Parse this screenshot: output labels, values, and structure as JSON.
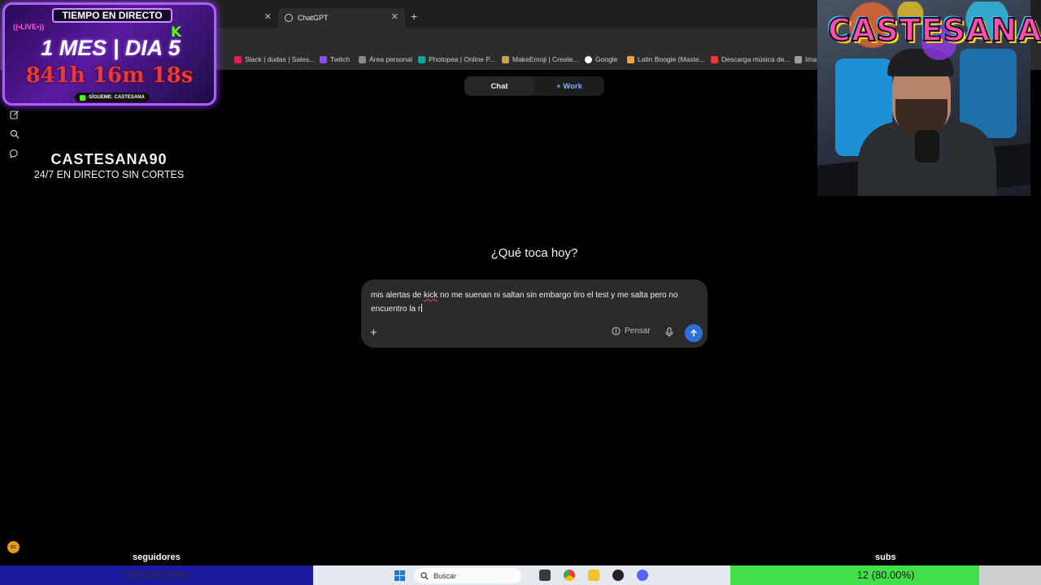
{
  "browser": {
    "active_tab_title": "ChatGPT",
    "bookmarks": [
      {
        "label": "Slack | dudas | Sales...",
        "color": "#e01e5a"
      },
      {
        "label": "Twitch",
        "color": "#9146ff"
      },
      {
        "label": "Área personal",
        "color": "#888888"
      },
      {
        "label": "Photopea | Online P...",
        "color": "#18a497"
      },
      {
        "label": "MakeEmoji | Create...",
        "color": "#c8a24a"
      },
      {
        "label": "Google",
        "color": "#ffffff"
      },
      {
        "label": "Latin Boogie (Maste...",
        "color": "#f2a33a"
      },
      {
        "label": "Descarga música de...",
        "color": "#e53935"
      },
      {
        "label": "Ima",
        "color": "#9e9e9e"
      }
    ]
  },
  "chatgpt": {
    "mode_chat": "Chat",
    "mode_work": "+ Work",
    "headline": "¿Qué toca hoy?",
    "prompt_before": "mis alertas de ",
    "prompt_misspelled": "kick",
    "prompt_after": " no me suenan ni saltan sin embargo tiro el test y me salta pero no encuentro la r",
    "think_label": "Pensar",
    "sidebar_icons": [
      "new-chat-icon",
      "search-icon",
      "chat-bubble-icon"
    ]
  },
  "overlay": {
    "timer_header": "TIEMPO EN DIRECTO",
    "live_badge": "((•LIVE•))",
    "kick_logo": "K",
    "day_count": "1 MES | DIA 5",
    "countdown": "841h 16m 18s",
    "follow_text": "SÍGUEME: CASTESANA",
    "channel_name": "CASTESANA90",
    "channel_tagline": "24/7 EN DIRECTO SIN CORTES",
    "logo_text": "CASTESANA",
    "orange_badge": "DC"
  },
  "goals": {
    "followers_label": "seguidores",
    "followers_value": "130 (108.33%)",
    "followers_color": "#1b1a9f",
    "subs_label": "subs",
    "subs_value": "12 (80.00%)",
    "subs_progress": 0.8,
    "subs_color": "#41e04a"
  },
  "taskbar": {
    "search_placeholder": "Buscar"
  }
}
